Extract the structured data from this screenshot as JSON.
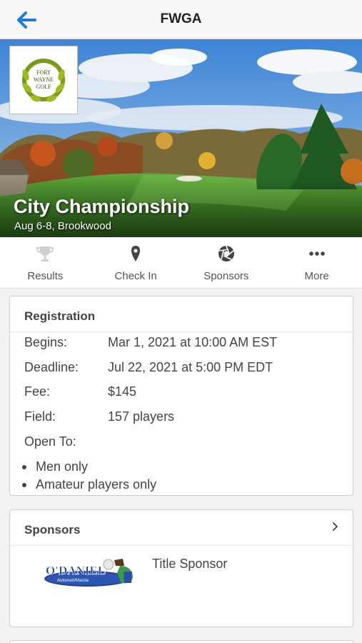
{
  "app": {
    "title": "FWGA"
  },
  "event": {
    "name": "City Championship",
    "subtitle": "Aug 6-8, Brookwood",
    "club_logo_text": [
      "FORT",
      "WAYNE",
      "GOLF"
    ]
  },
  "tabs": [
    {
      "label": "Results",
      "icon": "trophy-icon"
    },
    {
      "label": "Check In",
      "icon": "map-pin-icon"
    },
    {
      "label": "Sponsors",
      "icon": "aperture-icon"
    },
    {
      "label": "More",
      "icon": "ellipsis-icon"
    }
  ],
  "registration": {
    "title": "Registration",
    "rows": [
      {
        "label": "Begins:",
        "value": "Mar 1, 2021 at 10:00 AM EST"
      },
      {
        "label": "Deadline:",
        "value": "Jul 22, 2021 at 5:00 PM EDT"
      },
      {
        "label": "Fee:",
        "value": "$145"
      },
      {
        "label": "Field:",
        "value": "157 players"
      }
    ],
    "open_to_label": "Open To:",
    "open_to": [
      "Men only",
      "Amateur players only"
    ]
  },
  "sponsors": {
    "title": "Sponsors",
    "items": [
      {
        "logo_text": "O'DANIEL",
        "logo_subtext": "Automart/Mazda",
        "level": "Title Sponsor"
      }
    ]
  },
  "colors": {
    "accent": "#1a7ce0",
    "sky": "#4a8fd8",
    "grass": "#3f8f2a"
  }
}
